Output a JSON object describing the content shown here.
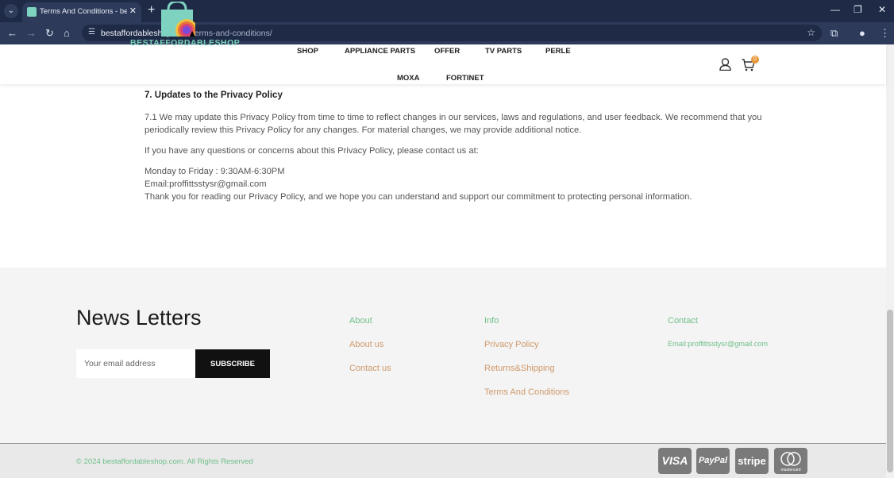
{
  "browser": {
    "tab_title": "Terms And Conditions - bestaff",
    "tab_close": "✕",
    "new_tab": "+",
    "url_domain": "bestaffordableshop.com",
    "url_path": "/terms-and-conditions/"
  },
  "header": {
    "logo_text": "BESTAFFORDABLESHOP",
    "nav": [
      "SHOP",
      "APPLIANCE PARTS",
      "OFFER",
      "TV PARTS",
      "PERLE",
      "MOXA",
      "FORTINET"
    ],
    "cart_count": "0"
  },
  "content": {
    "section_title": "7. Updates to the Privacy Policy",
    "p1": "7.1 We may update this Privacy Policy from time to time to reflect changes in our services, laws and regulations, and user feedback. We recommend that you periodically review this Privacy Policy for any changes. For material changes, we may provide additional notice.",
    "p2": "If you have any questions or concerns about this Privacy Policy, please contact us at:",
    "hours": "Monday to Friday : 9:30AM-6:30PM",
    "email": "Email:proffittsstysr@gmail.com",
    "thanks": "Thank you for reading our Privacy Policy, and we hope you can understand and support our commitment to protecting personal information."
  },
  "footer": {
    "news_title": "News Letters",
    "email_placeholder": "Your email address",
    "subscribe": "SUBSCRIBE",
    "col_about": {
      "title": "About",
      "links": [
        "About us",
        "Contact us"
      ]
    },
    "col_info": {
      "title": "Info",
      "links": [
        "Privacy Policy",
        "Returns&Shipping",
        "Terms And Conditions"
      ]
    },
    "col_contact": {
      "title": "Contact",
      "email": "Email:proffittsstysr@gmail.com"
    },
    "copyright": "© 2024 bestaffordableshop.com. All Rights Reserved",
    "payments": [
      "VISA",
      "PayPal",
      "stripe",
      "mastercard"
    ]
  },
  "colors": {
    "accent_green": "#6fbf8a",
    "link_orange": "#cf9a6c",
    "chrome": "#1e2a46"
  }
}
